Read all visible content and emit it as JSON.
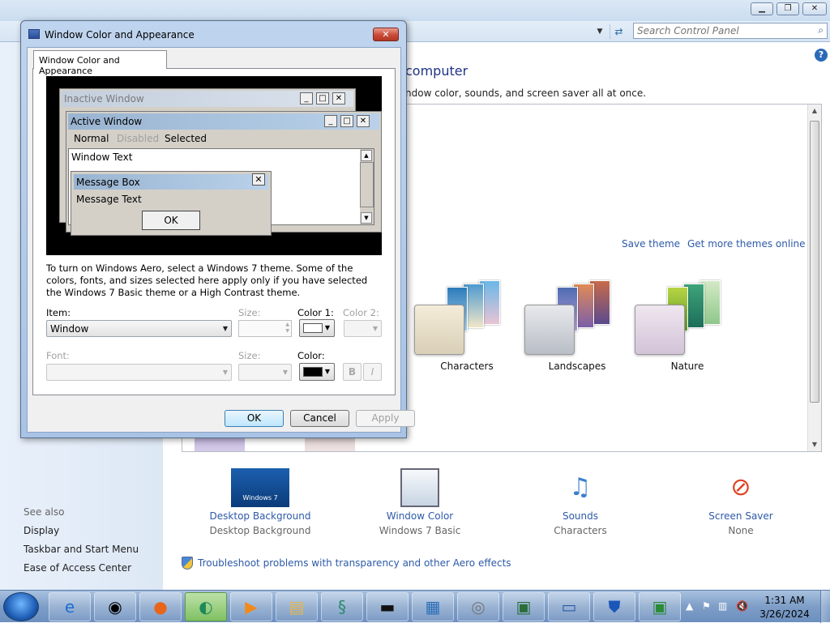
{
  "control_panel": {
    "search_placeholder": "Search Control Panel",
    "title_partial": "computer",
    "subtitle_partial": "ndow color, sounds, and screen saver all at once.",
    "save_theme": "Save theme",
    "get_more_themes": "Get more themes online",
    "themes": [
      {
        "label": "Characters"
      },
      {
        "label": "Landscapes"
      },
      {
        "label": "Nature"
      }
    ],
    "bottom_items": [
      {
        "link": "Desktop Background",
        "value": "Desktop Background",
        "thumb_text": "Windows 7"
      },
      {
        "link": "Window Color",
        "value": "Windows 7 Basic"
      },
      {
        "link": "Sounds",
        "value": "Characters"
      },
      {
        "link": "Screen Saver",
        "value": "None"
      }
    ],
    "troubleshoot": "Troubleshoot problems with transparency and other Aero effects",
    "see_also": "See also",
    "sidebar_links": [
      "Display",
      "Taskbar and Start Menu",
      "Ease of Access Center"
    ]
  },
  "dialog": {
    "title": "Window Color and Appearance",
    "tab": "Window Color and Appearance",
    "preview": {
      "inactive_title": "Inactive Window",
      "active_title": "Active Window",
      "menu_normal": "Normal",
      "menu_disabled": "Disabled",
      "menu_selected": "Selected",
      "window_text": "Window Text",
      "msgbox_title": "Message Box",
      "msgbox_text": "Message Text",
      "msgbox_ok": "OK"
    },
    "explanation": "To turn on Windows Aero, select a Windows 7 theme.  Some of the colors, fonts, and sizes selected here apply only if you have selected the Windows 7 Basic theme or a High Contrast theme.",
    "labels": {
      "item": "Item:",
      "size": "Size:",
      "color1": "Color 1:",
      "color2": "Color 2:",
      "font": "Font:",
      "font_size": "Size:",
      "font_color": "Color:"
    },
    "item_value": "Window",
    "color1_value": "#ffffff",
    "font_color_value": "#000000",
    "bold_label": "B",
    "italic_label": "I",
    "buttons": {
      "ok": "OK",
      "cancel": "Cancel",
      "apply": "Apply"
    }
  },
  "taskbar": {
    "time": "1:31 AM",
    "date": "3/26/2024",
    "buttons": [
      "ie-icon",
      "raccoon-app-icon",
      "firefox-icon",
      "active-app-icon",
      "media-player-icon",
      "explorer-icon",
      "app-icon",
      "cmd-icon",
      "control-panel-icon",
      "disc-icon",
      "monitor-icon",
      "window-icon",
      "aol-shield-icon",
      "network-display-icon"
    ]
  }
}
